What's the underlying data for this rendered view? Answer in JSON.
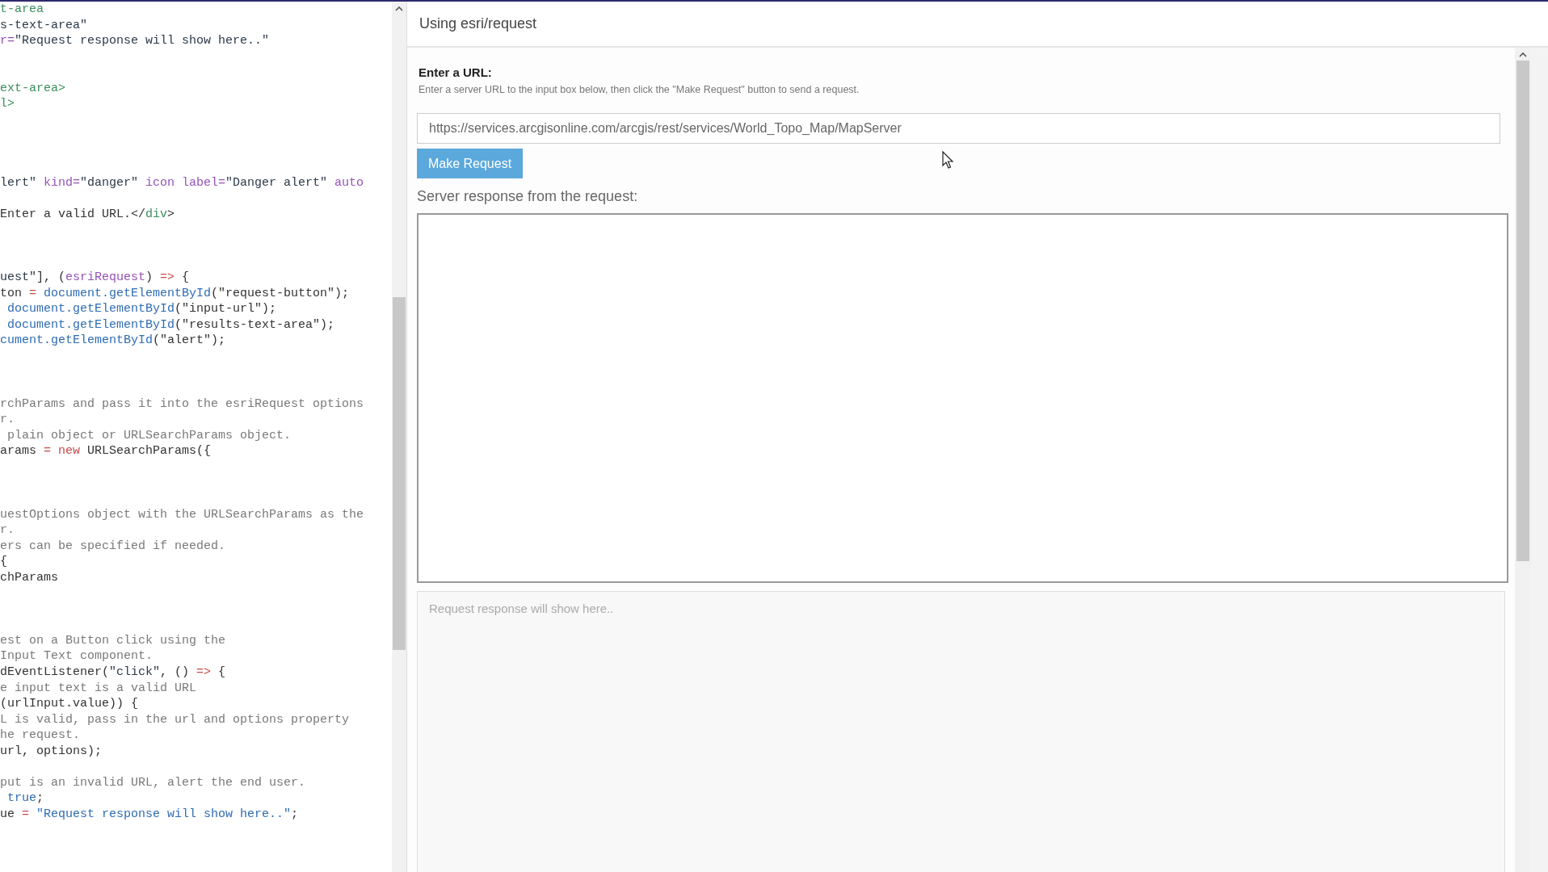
{
  "code_editor": {
    "lines": [
      {
        "kind": "code",
        "tokens": [
          {
            "kind": "tag",
            "text": "t-area"
          }
        ]
      },
      {
        "kind": "code",
        "tokens": [
          {
            "kind": "string",
            "text": "s-text-area\""
          }
        ]
      },
      {
        "kind": "code",
        "tokens": [
          {
            "kind": "attr",
            "text": "r="
          },
          {
            "kind": "string",
            "text": "\"Request response will show here..\""
          }
        ]
      },
      {
        "kind": "blank"
      },
      {
        "kind": "blank"
      },
      {
        "kind": "code",
        "tokens": [
          {
            "kind": "tag",
            "text": "ext-area>"
          }
        ]
      },
      {
        "kind": "code",
        "tokens": [
          {
            "kind": "tag",
            "text": "l>"
          }
        ]
      },
      {
        "kind": "blank"
      },
      {
        "kind": "blank"
      },
      {
        "kind": "blank"
      },
      {
        "kind": "blank"
      },
      {
        "kind": "code",
        "tokens": [
          {
            "kind": "string",
            "text": "lert\" "
          },
          {
            "kind": "attr",
            "text": "kind="
          },
          {
            "kind": "string",
            "text": "\"danger\" "
          },
          {
            "kind": "attr",
            "text": "icon label="
          },
          {
            "kind": "string",
            "text": "\"Danger alert\" "
          },
          {
            "kind": "attr",
            "text": "auto"
          }
        ]
      },
      {
        "kind": "blank"
      },
      {
        "kind": "code",
        "tokens": [
          {
            "kind": "plain",
            "text": "Enter a valid URL.</"
          },
          {
            "kind": "tag",
            "text": "div"
          },
          {
            "kind": "plain",
            "text": ">"
          }
        ]
      },
      {
        "kind": "blank"
      },
      {
        "kind": "blank"
      },
      {
        "kind": "blank"
      },
      {
        "kind": "code",
        "tokens": [
          {
            "kind": "string",
            "text": "uest\""
          },
          {
            "kind": "plain",
            "text": "], ("
          },
          {
            "kind": "attr",
            "text": "esriRequest"
          },
          {
            "kind": "plain",
            "text": ") "
          },
          {
            "kind": "keyword",
            "text": "=>"
          },
          {
            "kind": "plain",
            "text": " {"
          }
        ]
      },
      {
        "kind": "code",
        "tokens": [
          {
            "kind": "plain",
            "text": "ton "
          },
          {
            "kind": "keyword",
            "text": "="
          },
          {
            "kind": "func",
            "text": " document.getElementById"
          },
          {
            "kind": "plain",
            "text": "(\"request-button\");"
          }
        ]
      },
      {
        "kind": "code",
        "tokens": [
          {
            "kind": "func",
            "text": " document.getElementById"
          },
          {
            "kind": "plain",
            "text": "(\"input-url\");"
          }
        ]
      },
      {
        "kind": "code",
        "tokens": [
          {
            "kind": "func",
            "text": " document.getElementById"
          },
          {
            "kind": "plain",
            "text": "(\"results-text-area\");"
          }
        ]
      },
      {
        "kind": "code",
        "tokens": [
          {
            "kind": "func",
            "text": "cument.getElementById"
          },
          {
            "kind": "plain",
            "text": "(\"alert\");"
          }
        ]
      },
      {
        "kind": "blank"
      },
      {
        "kind": "blank"
      },
      {
        "kind": "blank"
      },
      {
        "kind": "code",
        "tokens": [
          {
            "kind": "comment",
            "text": "rchParams and pass it into the esriRequest options"
          }
        ]
      },
      {
        "kind": "code",
        "tokens": [
          {
            "kind": "comment",
            "text": "r."
          }
        ]
      },
      {
        "kind": "code",
        "tokens": [
          {
            "kind": "comment",
            "text": " plain object or URLSearchParams object."
          }
        ]
      },
      {
        "kind": "code",
        "tokens": [
          {
            "kind": "plain",
            "text": "arams "
          },
          {
            "kind": "keyword",
            "text": "="
          },
          {
            "kind": "keyword",
            "text": " new"
          },
          {
            "kind": "plain",
            "text": " URLSearchParams({"
          }
        ]
      },
      {
        "kind": "blank"
      },
      {
        "kind": "blank"
      },
      {
        "kind": "blank"
      },
      {
        "kind": "code",
        "tokens": [
          {
            "kind": "comment",
            "text": "uestOptions object with the URLSearchParams as the"
          }
        ]
      },
      {
        "kind": "code",
        "tokens": [
          {
            "kind": "comment",
            "text": "r."
          }
        ]
      },
      {
        "kind": "code",
        "tokens": [
          {
            "kind": "comment",
            "text": "ers can be specified if needed."
          }
        ]
      },
      {
        "kind": "code",
        "tokens": [
          {
            "kind": "plain",
            "text": "{"
          }
        ]
      },
      {
        "kind": "code",
        "tokens": [
          {
            "kind": "plain",
            "text": "chParams"
          }
        ]
      },
      {
        "kind": "blank"
      },
      {
        "kind": "blank"
      },
      {
        "kind": "blank"
      },
      {
        "kind": "code",
        "tokens": [
          {
            "kind": "comment",
            "text": "est on a Button click using the"
          }
        ]
      },
      {
        "kind": "code",
        "tokens": [
          {
            "kind": "comment",
            "text": "Input Text component."
          }
        ]
      },
      {
        "kind": "code",
        "tokens": [
          {
            "kind": "plain",
            "text": "dEventListener("
          },
          {
            "kind": "string",
            "text": "\"click\""
          },
          {
            "kind": "plain",
            "text": ", () "
          },
          {
            "kind": "keyword",
            "text": "=>"
          },
          {
            "kind": "plain",
            "text": " {"
          }
        ]
      },
      {
        "kind": "code",
        "tokens": [
          {
            "kind": "comment",
            "text": "e input text is a valid URL"
          }
        ]
      },
      {
        "kind": "code",
        "tokens": [
          {
            "kind": "plain",
            "text": "(urlInput.value)) {"
          }
        ]
      },
      {
        "kind": "code",
        "tokens": [
          {
            "kind": "comment",
            "text": "L is valid, pass in the url and options property"
          }
        ]
      },
      {
        "kind": "code",
        "tokens": [
          {
            "kind": "comment",
            "text": "he request."
          }
        ]
      },
      {
        "kind": "code",
        "tokens": [
          {
            "kind": "plain",
            "text": "url, options);"
          }
        ]
      },
      {
        "kind": "blank"
      },
      {
        "kind": "code",
        "tokens": [
          {
            "kind": "comment",
            "text": "put is an invalid URL, alert the end user."
          }
        ]
      },
      {
        "kind": "code",
        "tokens": [
          {
            "kind": "func",
            "text": " true"
          },
          {
            "kind": "plain",
            "text": ";"
          }
        ]
      },
      {
        "kind": "code",
        "tokens": [
          {
            "kind": "plain",
            "text": "ue "
          },
          {
            "kind": "keyword",
            "text": "="
          },
          {
            "kind": "func",
            "text": " \"Request response will show here..\""
          },
          {
            "kind": "plain",
            "text": ";"
          }
        ]
      }
    ]
  },
  "preview": {
    "title": "Using esri/request",
    "url_label": "Enter a URL:",
    "url_hint": "Enter a server URL to the input box below, then click the \"Make Request\" button to send a request.",
    "url_input": {
      "value": "https://services.arcgisonline.com/arcgis/rest/services/World_Topo_Map/MapServer"
    },
    "button": "Make Request",
    "response_label": "Server response from the request:",
    "results": {
      "placeholder": "Request response will show here.."
    }
  }
}
